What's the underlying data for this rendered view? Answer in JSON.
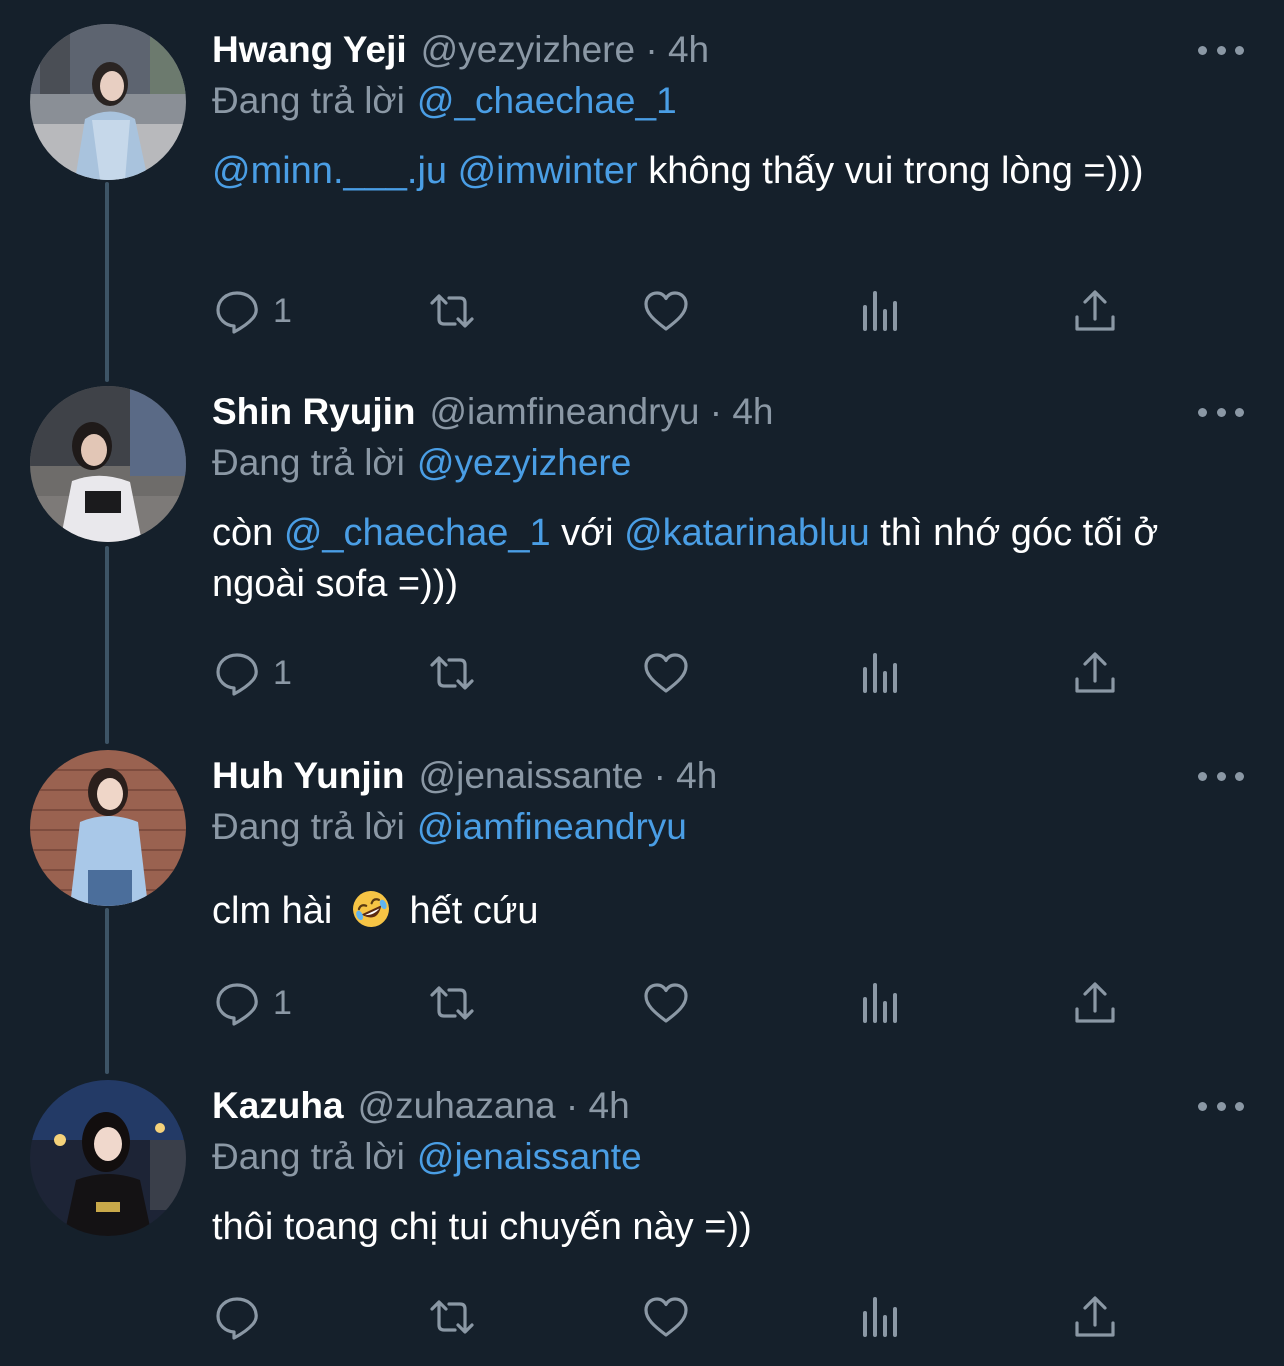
{
  "colors": {
    "background": "#15202b",
    "link": "#4a9ee5",
    "muted": "#8b98a5",
    "thread_line": "#3d5466"
  },
  "tweets": [
    {
      "name": "Hwang Yeji",
      "handle": "@yezyizhere · 4h",
      "replying_label": "Đang trả lời",
      "replying_to": "@_chaechae_1",
      "body": [
        {
          "text": "@minn.___.ju",
          "link": true
        },
        {
          "text": " ",
          "link": false
        },
        {
          "text": "@imwinter",
          "link": true
        },
        {
          "text": " không thấy vui trong lòng =)))",
          "link": false
        }
      ],
      "reply_count": "1"
    },
    {
      "name": "Shin Ryujin",
      "handle": "@iamfineandryu · 4h",
      "replying_label": "Đang trả lời",
      "replying_to": "@yezyizhere",
      "body": [
        {
          "text": "còn ",
          "link": false
        },
        {
          "text": "@_chaechae_1",
          "link": true
        },
        {
          "text": " với ",
          "link": false
        },
        {
          "text": "@katarinabluu",
          "link": true
        },
        {
          "text": " thì nhớ góc tối ở ngoài sofa =)))",
          "link": false
        }
      ],
      "reply_count": "1"
    },
    {
      "name": "Huh Yunjin",
      "handle": "@jenaissante · 4h",
      "replying_label": "Đang trả lời",
      "replying_to": "@iamfineandryu",
      "body": [
        {
          "text": "clm hài",
          "link": false
        },
        {
          "emoji": "rofl-emoji"
        },
        {
          "text": " hết cứu",
          "link": false
        }
      ],
      "reply_count": "1"
    },
    {
      "name": "Kazuha",
      "handle": "@zuhazana · 4h",
      "replying_label": "Đang trả lời",
      "replying_to": "@jenaissante",
      "body": [
        {
          "text": "thôi toang chị tui chuyến này =))",
          "link": false
        }
      ],
      "reply_count": ""
    }
  ],
  "icons": {
    "reply": "reply-icon",
    "retweet": "retweet-icon",
    "like": "heart-icon",
    "views": "analytics-icon",
    "share": "share-icon",
    "more": "more-dots-icon"
  }
}
